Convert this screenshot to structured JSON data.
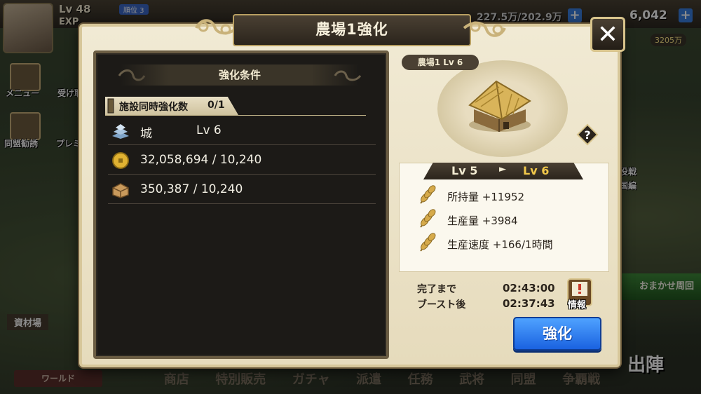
{
  "background": {
    "player_level": "Lv 48",
    "exp_label": "EXP",
    "rank_badge": "順位 3",
    "resource_left": "227.5万/202.9万",
    "coins": "6,042",
    "coins_sub": "3205万",
    "side_menu": [
      "メニュー",
      "受け取",
      "同盟勧誘",
      "プレミ宝"
    ],
    "right_labels": [
      "役戦",
      "国編"
    ],
    "auto_button": "おまかせ周回",
    "sortie_label": "出陣",
    "bottom_nav": [
      "商店",
      "特別販売",
      "ガチャ",
      "派遣",
      "任務",
      "武将",
      "同盟",
      "争覇戦"
    ],
    "world_button": "ワールド",
    "resource_field_label": "資材場"
  },
  "modal": {
    "title": "農場1強化",
    "close_glyph": "✕",
    "conditions": {
      "header": "強化条件",
      "simultaneous_label": "施設同時強化数",
      "simultaneous_value": "0/1",
      "rows": [
        {
          "icon": "castle-icon",
          "name": "城",
          "level": "Lv 6",
          "text": ""
        },
        {
          "icon": "gold-coin-icon",
          "name": "",
          "level": "",
          "text": "32,058,694 / 10,240"
        },
        {
          "icon": "wood-icon",
          "name": "",
          "level": "",
          "text": "350,387 / 10,240"
        }
      ]
    },
    "building": {
      "name_level": "農場1 Lv 6",
      "help_glyph": "?"
    },
    "level_change": {
      "from": "Lv 5",
      "arrow": "►",
      "to": "Lv 6"
    },
    "stats": [
      {
        "icon": "wheat-icon",
        "text": "所持量 +11952"
      },
      {
        "icon": "wheat-icon",
        "text": "生産量 +3984"
      },
      {
        "icon": "wheat-icon",
        "text": "生産速度 +166/1時間"
      }
    ],
    "time": {
      "complete_label": "完了まで",
      "complete_value": "02:43:00",
      "boost_label": "ブースト後",
      "boost_value": "02:37:43"
    },
    "info_label": "情報",
    "upgrade_button": "強化"
  },
  "colors": {
    "upgrade_button": "#2a7bf0",
    "level_to": "#f2c84a",
    "panel_dark": "#1c1a17",
    "frame_gold": "#d7c79a"
  }
}
